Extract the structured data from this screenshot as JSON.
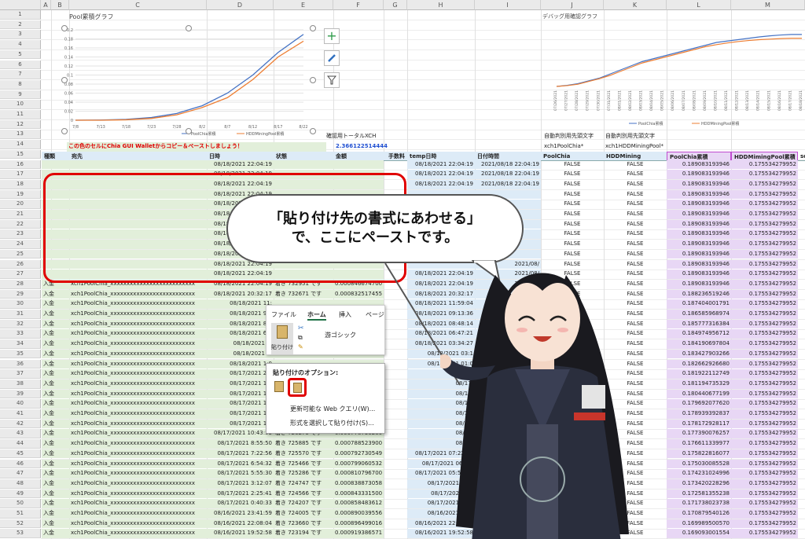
{
  "columns": [
    "A",
    "B",
    "C",
    "D",
    "E",
    "F",
    "G",
    "H",
    "I",
    "J",
    "K",
    "L",
    "M"
  ],
  "row_numbers": [
    "1",
    "2",
    "3",
    "4",
    "5",
    "6",
    "7",
    "8",
    "9",
    "10",
    "11",
    "12",
    "13",
    "14",
    "15",
    "16",
    "17",
    "18",
    "19",
    "20",
    "21",
    "22",
    "23",
    "24",
    "25",
    "26",
    "27",
    "28",
    "29",
    "30",
    "31",
    "32",
    "33",
    "34",
    "35",
    "36",
    "37",
    "38",
    "39",
    "40",
    "41",
    "42",
    "43",
    "44",
    "45",
    "46",
    "47",
    "48",
    "49",
    "50",
    "51",
    "52",
    "53"
  ],
  "chart1": {
    "title": "Pool累積グラフ",
    "x_ticks": [
      "7/8",
      "7/13",
      "7/18",
      "7/23",
      "7/28",
      "8/2",
      "8/7",
      "8/12",
      "8/17",
      "8/22"
    ],
    "y_ticks": [
      "0.2",
      "0.18",
      "0.16",
      "0.14",
      "0.12",
      "0.1",
      "0.08",
      "0.06",
      "0.04",
      "0.02",
      "0"
    ],
    "legend": [
      "PoolChia累積",
      "HDDMiningPool累積"
    ]
  },
  "chart2": {
    "title": "デバッグ用確認グラフ",
    "legend": [
      "PoolChia累積",
      "HDDMiningPool累積"
    ],
    "x_ticks": [
      "07/26/2021",
      "07/27/2021",
      "07/28/2021",
      "07/29/2021",
      "07/30/2021",
      "07/31/2021",
      "08/01/2021",
      "08/02/2021",
      "08/03/2021",
      "08/04/2021",
      "08/05/2021",
      "08/06/2021",
      "08/07/2021",
      "08/08/2021",
      "08/09/2021",
      "08/10/2021",
      "08/11/2021",
      "08/12/2021",
      "08/13/2021",
      "08/14/2021",
      "08/15/2021",
      "08/16/2021",
      "08/17/2021",
      "08/18/2021"
    ]
  },
  "chart_data": [
    {
      "type": "line",
      "title": "Pool累積グラフ",
      "x": [
        "7/8",
        "7/13",
        "7/18",
        "7/23",
        "7/28",
        "8/2",
        "8/7",
        "8/12",
        "8/17",
        "8/22"
      ],
      "ylim": [
        0,
        0.2
      ],
      "series": [
        {
          "name": "PoolChia累積",
          "color": "#4472c4",
          "values": [
            0,
            0.0005,
            0.002,
            0.006,
            0.015,
            0.032,
            0.06,
            0.1,
            0.15,
            0.19
          ]
        },
        {
          "name": "HDDMiningPool累積",
          "color": "#ed7d31",
          "values": [
            0,
            0,
            0.001,
            0.004,
            0.012,
            0.028,
            0.05,
            0.09,
            0.14,
            0.175
          ]
        }
      ]
    },
    {
      "type": "line",
      "title": "デバッグ用確認グラフ",
      "ylim": [
        0,
        0.2
      ],
      "series": [
        {
          "name": "PoolChia累積",
          "color": "#4472c4",
          "values": [
            0,
            0.004,
            0.01,
            0.02,
            0.03,
            0.045,
            0.06,
            0.075,
            0.09,
            0.1,
            0.11,
            0.12,
            0.13,
            0.14,
            0.15,
            0.16,
            0.165,
            0.17,
            0.175,
            0.18,
            0.184,
            0.187,
            0.189,
            0.189
          ]
        },
        {
          "name": "HDDMiningPool累積",
          "color": "#ed7d31",
          "values": [
            0,
            0.003,
            0.008,
            0.018,
            0.028,
            0.04,
            0.055,
            0.07,
            0.085,
            0.095,
            0.105,
            0.115,
            0.125,
            0.135,
            0.145,
            0.152,
            0.158,
            0.163,
            0.167,
            0.17,
            0.172,
            0.174,
            0.175,
            0.175
          ]
        }
      ]
    }
  ],
  "labels": {
    "paste_note": "この色のセルにChia GUI Walletからコピー＆ペーストしましょう！",
    "total_label": "確認用トータルXCH",
    "total_value": "2.366122514444",
    "auto_label1": "自動判別用先頭文字",
    "auto_label2": "自動判別用先頭文字",
    "auto_val1": "xch1PoolChia*",
    "auto_val2": "xch1HDDMiningPool*"
  },
  "headers": {
    "b": "種類",
    "c": "宛先",
    "d": "日時",
    "e": "状態",
    "f": "金額",
    "g": "手数料",
    "h": "temp日時",
    "i": "日付時間",
    "j": "PoolChia",
    "k": "HDDMining",
    "l": "PoolChia累積",
    "m": "HDDMimingPool累積",
    "n": "so"
  },
  "rows": [
    {
      "b": "",
      "c": "",
      "d": "08/18/2021 22:04:19",
      "e": "",
      "f": "",
      "h": "08/18/2021 22:04:19",
      "i": "2021/08/18 22:04:19",
      "j": "FALSE",
      "k": "FALSE",
      "l": "0.189083193946",
      "m": "0.175534279952"
    },
    {
      "b": "",
      "c": "",
      "d": "08/18/2021 22:04:19",
      "e": "",
      "f": "",
      "h": "08/18/2021 22:04:19",
      "i": "2021/08/18 22:04:19",
      "j": "FALSE",
      "k": "FALSE",
      "l": "0.189083193946",
      "m": "0.175534279952"
    },
    {
      "b": "",
      "c": "",
      "d": "08/18/2021 22:04:19",
      "e": "",
      "f": "",
      "h": "08/18/2021 22:04:19",
      "i": "2021/08/18 22:04:19",
      "j": "FALSE",
      "k": "FALSE",
      "l": "0.189083193946",
      "m": "0.175534279952"
    },
    {
      "b": "",
      "c": "",
      "d": "08/18/2021 22:04:19",
      "e": "",
      "f": "",
      "h": "",
      "i": "",
      "j": "FALSE",
      "k": "FALSE",
      "l": "0.189083193946",
      "m": "0.175534279952"
    },
    {
      "b": "",
      "c": "",
      "d": "08/18/2021 22:04:19",
      "e": "",
      "f": "",
      "h": "",
      "i": "",
      "j": "FALSE",
      "k": "FALSE",
      "l": "0.189083193946",
      "m": "0.175534279952"
    },
    {
      "b": "",
      "c": "",
      "d": "08/18/2021 22:04:19",
      "e": "",
      "f": "",
      "h": "",
      "i": "",
      "j": "FALSE",
      "k": "FALSE",
      "l": "0.189083193946",
      "m": "0.175534279952"
    },
    {
      "b": "",
      "c": "",
      "d": "08/18/2021 22:04:19",
      "e": "",
      "f": "",
      "h": "",
      "i": "",
      "j": "FALSE",
      "k": "FALSE",
      "l": "0.189083193946",
      "m": "0.175534279952"
    },
    {
      "b": "",
      "c": "",
      "d": "08/18/2021 22:04:19",
      "e": "",
      "f": "",
      "h": "",
      "i": "",
      "j": "FALSE",
      "k": "FALSE",
      "l": "0.189083193946",
      "m": "0.175534279952"
    },
    {
      "b": "",
      "c": "",
      "d": "08/18/2021 22:04:19",
      "e": "",
      "f": "",
      "h": "",
      "i": "",
      "j": "FALSE",
      "k": "FALSE",
      "l": "0.189083193946",
      "m": "0.175534279952"
    },
    {
      "b": "",
      "c": "",
      "d": "08/18/2021 22:04:19",
      "e": "",
      "f": "",
      "h": "",
      "i": "",
      "j": "FALSE",
      "k": "FALSE",
      "l": "0.189083193946",
      "m": "0.175534279952"
    },
    {
      "b": "",
      "c": "",
      "d": "08/18/2021 22:04:19",
      "e": "",
      "f": "",
      "h": "",
      "i": "2021/08/",
      "j": "FALSE",
      "k": "FALSE",
      "l": "0.189083193946",
      "m": "0.175534279952"
    },
    {
      "b": "",
      "c": "",
      "d": "08/18/2021 22:04:19",
      "e": "",
      "f": "",
      "h": "08/18/2021 22:04:19",
      "i": "2021/08/",
      "j": "FALSE",
      "k": "FALSE",
      "l": "0.189083193946",
      "m": "0.175534279952"
    },
    {
      "b": "入金",
      "c": "xch1PoolChia_xxxxxxxxxxxxxxxxxxxxxxxxxx",
      "d": "08/18/2021 22:04:19",
      "e": "着き 732951 です",
      "f": "0.000846674700",
      "h": "08/18/2021 22:04:19",
      "i": "2021/08/",
      "j": "FALSE",
      "k": "FALSE",
      "l": "0.189083193946",
      "m": "0.175534279952"
    },
    {
      "b": "入金",
      "c": "xch1PoolChia_xxxxxxxxxxxxxxxxxxxxxxxxxx",
      "d": "08/18/2021 20:32:17",
      "e": "着き 732671 です",
      "f": "0.000832517455",
      "h": "08/18/2021 20:32:17",
      "i": "",
      "j": "FALSE",
      "k": "FALSE",
      "l": "0.188236519246",
      "m": "0.175534279952"
    },
    {
      "b": "入金",
      "c": "xch1PoolChia_xxxxxxxxxxxxxxxxxxxxxxxxxx",
      "d": "08/18/2021 11:",
      "e": "",
      "f": "",
      "h": "08/18/2021 11:59:04",
      "i": "",
      "j": "FALSE",
      "k": "FALSE",
      "l": "0.187404001791",
      "m": "0.175534279952"
    },
    {
      "b": "入金",
      "c": "xch1PoolChia_xxxxxxxxxxxxxxxxxxxxxxxxxx",
      "d": "08/18/2021 9:1",
      "e": "",
      "f": "",
      "h": "08/18/2021 09:13:36",
      "i": "",
      "j": "FALSE",
      "k": "FALSE",
      "l": "0.186585968974",
      "m": "0.175534279952"
    },
    {
      "b": "入金",
      "c": "xch1PoolChia_xxxxxxxxxxxxxxxxxxxxxxxxxx",
      "d": "08/18/2021 8:4",
      "e": "",
      "f": "",
      "h": "08/18/2021 08:48:14",
      "i": "",
      "j": "FALSE",
      "k": "FALSE",
      "l": "0.185777316384",
      "m": "0.175534279952"
    },
    {
      "b": "入金",
      "c": "xch1PoolChia_xxxxxxxxxxxxxxxxxxxxxxxxxx",
      "d": "08/18/2021 6:4",
      "e": "",
      "f": "",
      "h": "08/18/2021 06:47:21",
      "i": "",
      "j": "FALSE",
      "k": "FALSE",
      "l": "0.184974956712",
      "m": "0.175534279952"
    },
    {
      "b": "入金",
      "c": "xch1PoolChia_xxxxxxxxxxxxxxxxxxxxxxxxxx",
      "d": "08/18/2021 3:",
      "e": "",
      "f": "",
      "h": "08/18/2021 03:34:27",
      "i": "",
      "j": "FALSE",
      "k": "FALSE",
      "l": "0.184190697804",
      "m": "0.175534279952"
    },
    {
      "b": "入金",
      "c": "xch1PoolChia_xxxxxxxxxxxxxxxxxxxxxxxxxx",
      "d": "08/18/2021 3:",
      "e": "",
      "f": "",
      "h": "08/18/2021 03:1",
      "i": "",
      "j": "FALSE",
      "k": "FALSE",
      "l": "0.183427903266",
      "m": "0.175534279952"
    },
    {
      "b": "入金",
      "c": "xch1PoolChia_xxxxxxxxxxxxxxxxxxxxxxxxxx",
      "d": "08/18/2021 1:0",
      "e": "",
      "f": "",
      "h": "08/18/2021 01:0",
      "i": "",
      "j": "FALSE",
      "k": "FALSE",
      "l": "0.182662926680",
      "m": "0.175534279952"
    },
    {
      "b": "入金",
      "c": "xch1PoolChia_xxxxxxxxxxxxxxxxxxxxxxxxxx",
      "d": "08/17/2021 20:",
      "e": "",
      "f": "",
      "h": "",
      "i": "",
      "j": "FALSE",
      "k": "FALSE",
      "l": "0.181922112749",
      "m": "0.175534279952"
    },
    {
      "b": "入金",
      "c": "xch1PoolChia_xxxxxxxxxxxxxxxxxxxxxxxxxx",
      "d": "08/17/2021 18:",
      "e": "",
      "f": "",
      "h": "08/17/",
      "i": "",
      "j": "FALSE",
      "k": "FALSE",
      "l": "0.181194735329",
      "m": "0.175534279952"
    },
    {
      "b": "入金",
      "c": "xch1PoolChia_xxxxxxxxxxxxxxxxxxxxxxxxxx",
      "d": "08/17/2021 15:",
      "e": "",
      "f": "",
      "h": "08/17/",
      "i": "",
      "j": "FALSE",
      "k": "FALSE",
      "l": "0.180440677199",
      "m": "0.175534279952"
    },
    {
      "b": "入金",
      "c": "xch1PoolChia_xxxxxxxxxxxxxxxxxxxxxxxxxx",
      "d": "08/17/2021 15:",
      "e": "",
      "f": "",
      "h": "08/17/",
      "i": "",
      "j": "FALSE",
      "k": "FALSE",
      "l": "0.179692077620",
      "m": "0.175534279952"
    },
    {
      "b": "入金",
      "c": "xch1PoolChia_xxxxxxxxxxxxxxxxxxxxxxxxxx",
      "d": "08/17/2021 12:",
      "e": "",
      "f": "",
      "h": "08/17/",
      "i": "",
      "j": "FALSE",
      "k": "FALSE",
      "l": "0.178939392837",
      "m": "0.175534279952"
    },
    {
      "b": "入金",
      "c": "xch1PoolChia_xxxxxxxxxxxxxxxxxxxxxxxxxx",
      "d": "08/17/2021 11:",
      "e": "",
      "f": "",
      "h": "08/17/",
      "i": "",
      "j": "FALSE",
      "k": "FALSE",
      "l": "0.178172928117",
      "m": "0.175534279952"
    },
    {
      "b": "入金",
      "c": "xch1PoolChia_xxxxxxxxxxxxxxxxxxxxxxxxxx",
      "d": "08/17/2021 10:43:53",
      "e": "着き 726275 です",
      "f": "0.000778736280",
      "h": "08/17/",
      "i": "",
      "j": "FALSE",
      "k": "FALSE",
      "l": "0.177390076257",
      "m": "0.175534279952"
    },
    {
      "b": "入金",
      "c": "xch1PoolChia_xxxxxxxxxxxxxxxxxxxxxxxxxx",
      "d": "08/17/2021 8:55:50",
      "e": "着き 725885 です",
      "f": "0.000788523900",
      "h": "08/17/",
      "i": "",
      "j": "FALSE",
      "k": "FALSE",
      "l": "0.176611339977",
      "m": "0.175534279952"
    },
    {
      "b": "入金",
      "c": "xch1PoolChia_xxxxxxxxxxxxxxxxxxxxxxxxxx",
      "d": "08/17/2021 7:22:56",
      "e": "着き 725570 です",
      "f": "0.000792730549",
      "h": "08/17/2021 07:22:56",
      "i": "",
      "j": "FALSE",
      "k": "FALSE",
      "l": "0.175822816077",
      "m": "0.175534279952"
    },
    {
      "b": "入金",
      "c": "xch1PoolChia_xxxxxxxxxxxxxxxxxxxxxxxxxx",
      "d": "08/17/2021 6:54:32",
      "e": "着き 725466 です",
      "f": "0.000799060532",
      "h": "08/17/2021 06:54:",
      "i": "",
      "j": "FALSE",
      "k": "FALSE",
      "l": "0.175030085528",
      "m": "0.175534279952"
    },
    {
      "b": "入金",
      "c": "xch1PoolChia_xxxxxxxxxxxxxxxxxxxxxxxxxx",
      "d": "08/17/2021 5:55:30",
      "e": "着き 725286 です",
      "f": "0.000810796700",
      "h": "08/17/2021 05:55:30",
      "i": "",
      "j": "FALSE",
      "k": "FALSE",
      "l": "0.174231024996",
      "m": "0.175534279952"
    },
    {
      "b": "入金",
      "c": "xch1PoolChia_xxxxxxxxxxxxxxxxxxxxxxxxxx",
      "d": "08/17/2021 3:12:07",
      "e": "着き 724747 です",
      "f": "0.000838873058",
      "h": "08/17/2021 03:1",
      "i": "",
      "j": "FALSE",
      "k": "FALSE",
      "l": "0.173420228296",
      "m": "0.175534279952"
    },
    {
      "b": "入金",
      "c": "xch1PoolChia_xxxxxxxxxxxxxxxxxxxxxxxxxx",
      "d": "08/17/2021 2:25:41",
      "e": "着き 724566 です",
      "f": "0.000843331500",
      "h": "08/17/2021 02:",
      "i": "",
      "j": "FALSE",
      "k": "FALSE",
      "l": "0.172581355238",
      "m": "0.175534279952"
    },
    {
      "b": "入金",
      "c": "xch1PoolChia_xxxxxxxxxxxxxxxxxxxxxxxxxx",
      "d": "08/17/2021 0:40:33",
      "e": "着き 724207 です",
      "f": "0.000858483612",
      "h": "08/17/2021 00:4",
      "i": "",
      "j": "FALSE",
      "k": "FALSE",
      "l": "0.171738023738",
      "m": "0.175534279952"
    },
    {
      "b": "入金",
      "c": "xch1PoolChia_xxxxxxxxxxxxxxxxxxxxxxxxxx",
      "d": "08/16/2021 23:41:59",
      "e": "着き 724005 です",
      "f": "0.000890039556",
      "h": "08/16/2021 23:4",
      "i": "",
      "j": "FALSE",
      "k": "FALSE",
      "l": "0.170879540126",
      "m": "0.175534279952"
    },
    {
      "b": "入金",
      "c": "xch1PoolChia_xxxxxxxxxxxxxxxxxxxxxxxxxx",
      "d": "08/16/2021 22:08:04",
      "e": "着き 723660 です",
      "f": "0.000896499016",
      "h": "08/16/2021 22:08:04",
      "i": "",
      "j": "FALSE",
      "k": "FALSE",
      "l": "0.169989500570",
      "m": "0.175534279952"
    },
    {
      "b": "入金",
      "c": "xch1PoolChia_xxxxxxxxxxxxxxxxxxxxxxxxxx",
      "d": "08/16/2021 19:52:58",
      "e": "着き 723194 です",
      "f": "0.000919386571",
      "h": "08/16/2021 19:52:58",
      "i": "",
      "j": "FALSE",
      "k": "FALSE",
      "l": "0.169093001554",
      "m": "0.175534279952"
    }
  ],
  "callout": {
    "line1": "「貼り付け先の書式にあわせる」",
    "line2": "で、ここにペーストです。"
  },
  "ribbon": {
    "tab_file": "ファイル",
    "tab_home": "ホーム",
    "tab_insert": "挿入",
    "tab_page": "ページ",
    "paste_label": "貼り付け",
    "font_name": "游ゴシック"
  },
  "paste_menu": {
    "title": "貼り付けのオプション:",
    "item1": "更新可能な Web クエリ(W)...",
    "item2": "形式を選択して貼り付け(S)..."
  }
}
